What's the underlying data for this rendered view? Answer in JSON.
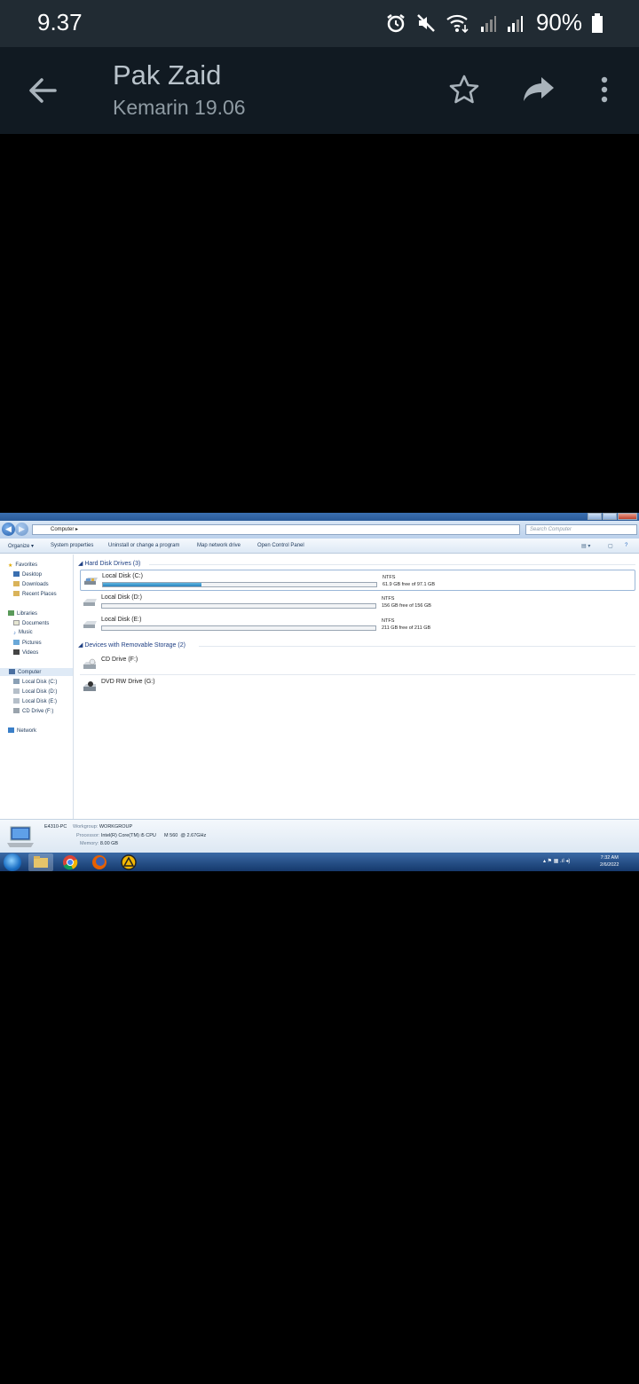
{
  "status_bar": {
    "time": "9.37",
    "battery": "90%"
  },
  "app_bar": {
    "title": "Pak Zaid",
    "subtitle": "Kemarin 19.06"
  },
  "screenshot": {
    "address": "Computer",
    "search_placeholder": "Search Computer",
    "toolbar": [
      "Organize ▾",
      "System properties",
      "Uninstall or change a program",
      "Map network drive",
      "Open Control Panel"
    ],
    "sidebar": {
      "favorites": "Favorites",
      "fav_items": [
        "Desktop",
        "Downloads",
        "Recent Places"
      ],
      "libraries": "Libraries",
      "lib_items": [
        "Documents",
        "Music",
        "Pictures",
        "Videos"
      ],
      "computer": "Computer",
      "comp_items": [
        "Local Disk (C:)",
        "Local Disk (D:)",
        "Local Disk (E:)",
        "CD Drive (F:)"
      ],
      "network": "Network"
    },
    "hard_disk_group": "Hard Disk Drives (3)",
    "drives": [
      {
        "name": "Local Disk (C:)",
        "fs": "NTFS",
        "free": "61.9 GB free of 97.1 GB",
        "used_fraction": 0.36
      },
      {
        "name": "Local Disk (D:)",
        "fs": "NTFS",
        "free": "156 GB free of 156 GB",
        "used_fraction": 0.0
      },
      {
        "name": "Local Disk (E:)",
        "fs": "NTFS",
        "free": "211 GB free of 211 GB",
        "used_fraction": 0.0
      }
    ],
    "removable_group": "Devices with Removable Storage (2)",
    "removable": [
      "CD Drive (F:)",
      "DVD RW Drive (G:)"
    ],
    "details": {
      "pc_name": "E4310-PC",
      "workgroup_label": "Workgroup:",
      "workgroup": "WORKGROUP",
      "processor_label": "Processor:",
      "processor": "Intel(R) Core(TM) i5 CPU      M 560  @ 2.67GHz",
      "memory_label": "Memory:",
      "memory": "8.00 GB"
    },
    "clock": {
      "time": "7:32 AM",
      "date": "2/6/2022"
    }
  }
}
